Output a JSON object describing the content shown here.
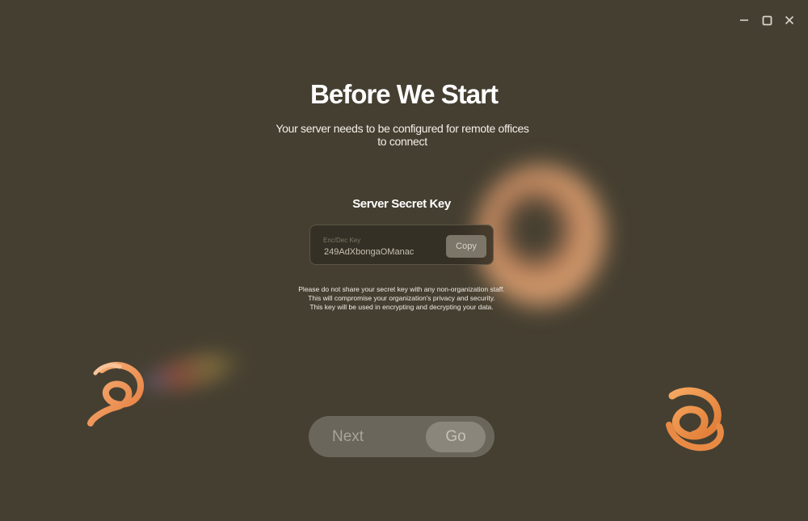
{
  "window": {
    "controls": [
      "minimize-icon",
      "maximize-icon",
      "close-icon"
    ]
  },
  "header": {
    "title": "Before We Start",
    "subtitle": "Your server needs to be configured for remote offices to connect"
  },
  "secret_key": {
    "heading": "Server Secret Key",
    "field_label": "Enc/Dec Key",
    "field_value": "249AdXbongaOManac",
    "copy_label": "Copy"
  },
  "warning": {
    "lines": [
      "Please do not share your secret key with any non-organization staff.",
      "This will compromise your organization's privacy and security.",
      "This key will be used in encrypting and decrypting your data."
    ]
  },
  "actions": {
    "next_label": "Next",
    "go_label": "Go"
  },
  "colors": {
    "background": "#453f31",
    "accent": "#e8884a",
    "button_track": "#6b665b",
    "button_thumb": "#8b867b"
  }
}
